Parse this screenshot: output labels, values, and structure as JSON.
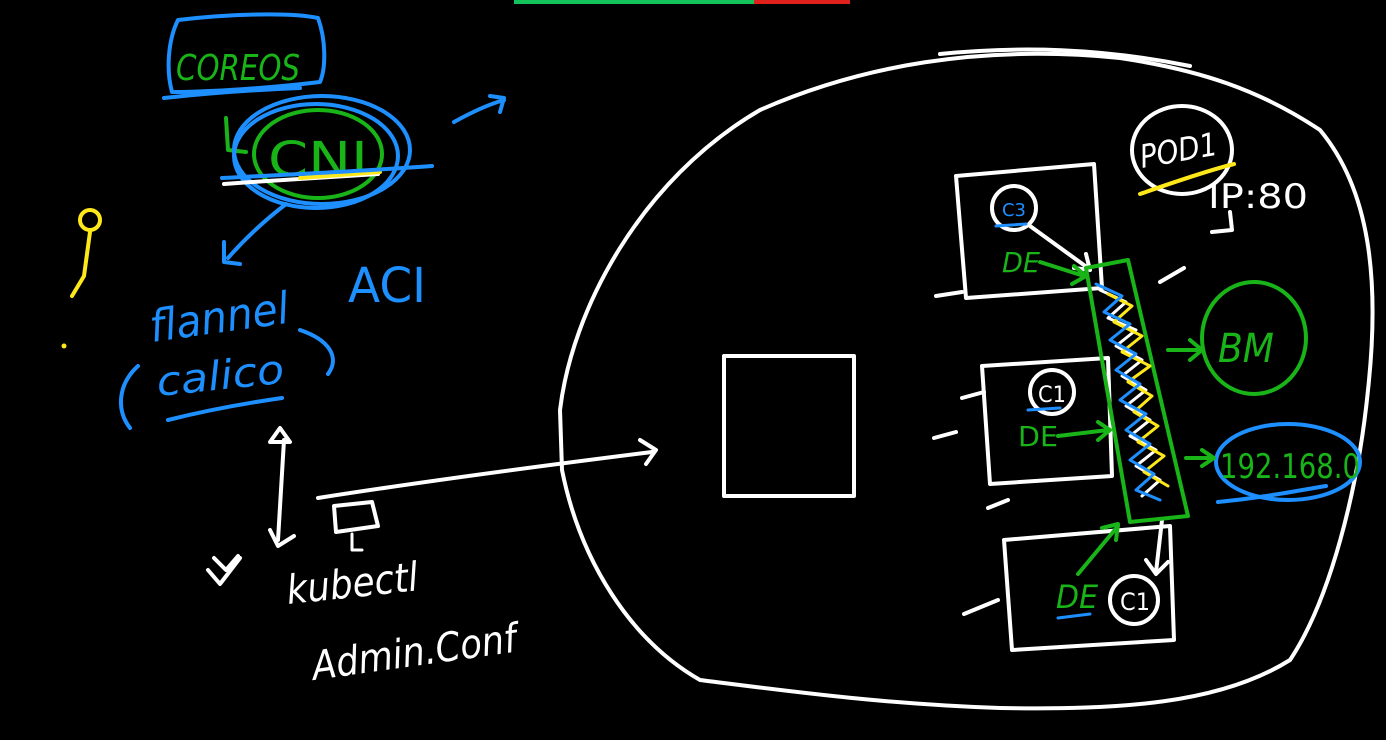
{
  "colors": {
    "background": "#000000",
    "white_ink": "#ffffff",
    "blue_ink": "#1e8fff",
    "green_ink": "#18b418",
    "yellow_ink": "#ffe81a",
    "toolbar_green": "#13c25a",
    "toolbar_red": "#e0201a"
  },
  "labels": {
    "coreos": "COREOS",
    "cni": "CNI",
    "flannel": "flannel",
    "calico": "calico",
    "aci": "ACI",
    "kubectl": "kubectl",
    "admin_conf": "Admin.Conf",
    "pod1": "POD1",
    "port": "IP:80",
    "c3": "C3",
    "c1a": "C1",
    "c1b": "C1",
    "de1": "DE",
    "de2": "DE",
    "de3": "DE",
    "bm": "BM",
    "ip": "192.168.0"
  },
  "icons": {
    "key": "key-icon",
    "check": "check-icon",
    "arrow": "arrow-icon"
  }
}
